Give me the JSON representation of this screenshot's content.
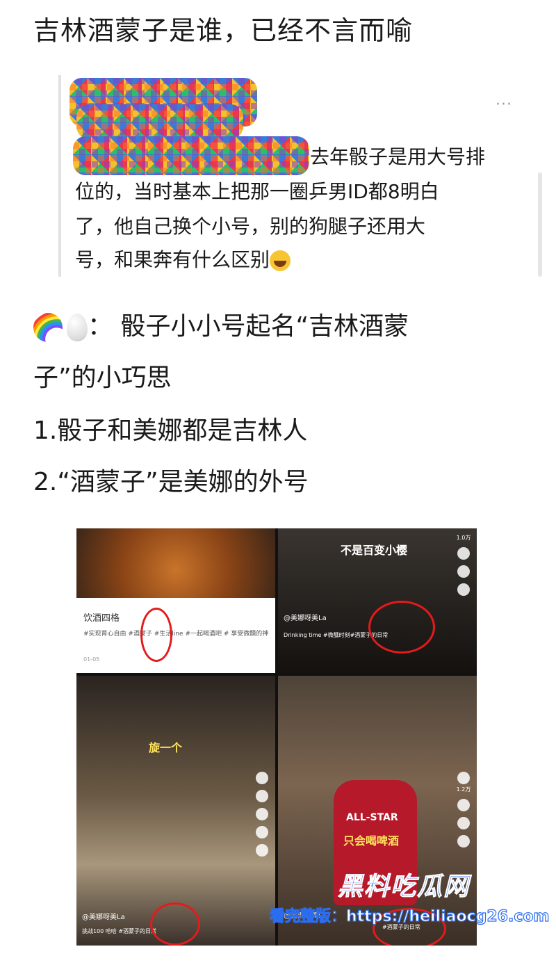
{
  "title": "吉林酒蒙子是谁，已经不言而喻",
  "quote": {
    "more": "···",
    "line1": "去年骰子是用大号排",
    "line2": "位的，当时基本上把那一圈乒男ID都8明白",
    "line3": "了，他自己换个小号，别的狗腿子还用大",
    "line4": "号，和果奔有什么区别"
  },
  "body": {
    "line1": "：  骰子小小号起名“吉林酒蒙",
    "line2": "子”的小巧思",
    "line3": "1.骰子和美娜都是吉林人",
    "line4": "2.“酒蒙子”是美娜的外号"
  },
  "collage": {
    "p1_caption": "饮酒四格",
    "p1_tags": "#实现育心自由 #酒蒙子 #生活line #一起喝酒吧 # 享受微醺的神",
    "p1_date": "01-05",
    "p2_banner": "不是百变小樱",
    "p2_user": "@美娜呀美La",
    "p2_desc": "Drinking time #微醺时刻#酒蒙子的日常",
    "p2_likes": "1.0万",
    "p3_text": "旋一个",
    "p3_user": "@美娜呀美La",
    "p3_desc": "挑战100 哈哈 #酒蒙子的日常",
    "p4_text": "只会喝啤酒",
    "p4_jersey": "ALL-STAR",
    "p4_user": "@美娜呀美La",
    "p4_desc": "#酒蒙子的日常",
    "p4_likes": "1.2万"
  },
  "watermark": {
    "site": "黑料吃瓜网",
    "url": "看完整版：https://heiliaocg26.com"
  }
}
